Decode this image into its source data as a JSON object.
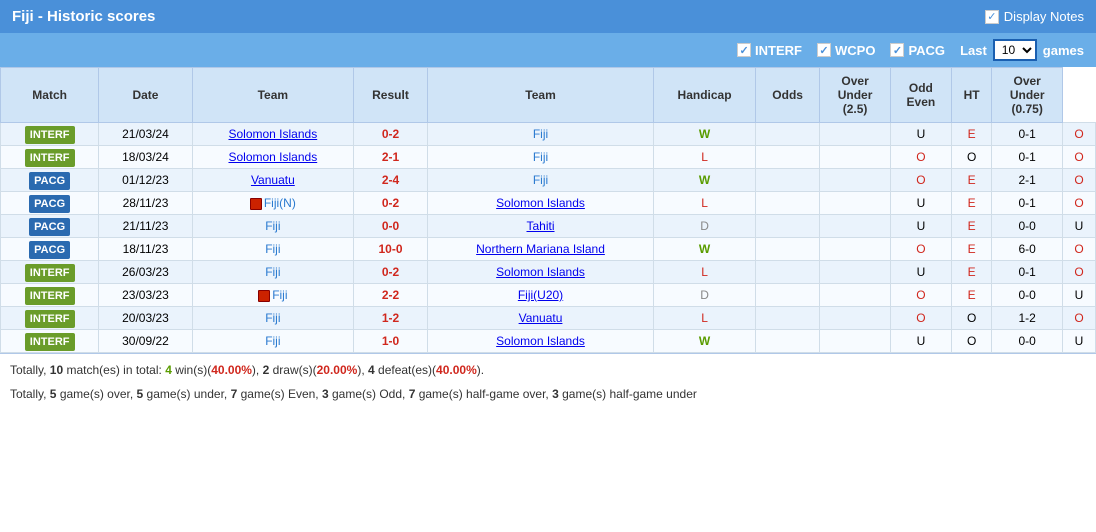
{
  "header": {
    "title": "Fiji - Historic scores",
    "display_notes_label": "Display Notes"
  },
  "filters": {
    "interf_label": "INTERF",
    "wcpo_label": "WCPO",
    "pacg_label": "PACG",
    "last_label": "Last",
    "games_label": "games",
    "last_value": "10"
  },
  "table": {
    "columns": [
      "Match",
      "Date",
      "Team",
      "Result",
      "Team",
      "Handicap",
      "Odds",
      "Over Under (2.5)",
      "Odd Even",
      "HT",
      "Over Under (0.75)"
    ],
    "rows": [
      {
        "type": "INTERF",
        "date": "21/03/24",
        "team1": "Solomon Islands",
        "team1_color": "black",
        "result": "0-2",
        "team2": "Fiji",
        "team2_color": "blue",
        "outcome": "W",
        "handicap": "",
        "odds": "",
        "ou25": "U",
        "oe": "E",
        "ht": "0-1",
        "ou075": "O"
      },
      {
        "type": "INTERF",
        "date": "18/03/24",
        "team1": "Solomon Islands",
        "team1_color": "black",
        "result": "2-1",
        "team2": "Fiji",
        "team2_color": "blue",
        "outcome": "L",
        "handicap": "",
        "odds": "",
        "ou25": "O",
        "oe": "O",
        "ht": "0-1",
        "ou075": "O"
      },
      {
        "type": "PACG",
        "date": "01/12/23",
        "team1": "Vanuatu",
        "team1_color": "black",
        "result": "2-4",
        "team2": "Fiji",
        "team2_color": "blue",
        "outcome": "W",
        "handicap": "",
        "odds": "",
        "ou25": "O",
        "oe": "E",
        "ht": "2-1",
        "ou075": "O"
      },
      {
        "type": "PACG",
        "date": "28/11/23",
        "team1": "Fiji(N)",
        "team1_color": "blue",
        "team1_flag": true,
        "result": "0-2",
        "team2": "Solomon Islands",
        "team2_color": "black",
        "outcome": "L",
        "handicap": "",
        "odds": "",
        "ou25": "U",
        "oe": "E",
        "ht": "0-1",
        "ou075": "O"
      },
      {
        "type": "PACG",
        "date": "21/11/23",
        "team1": "Fiji",
        "team1_color": "blue",
        "result": "0-0",
        "team2": "Tahiti",
        "team2_color": "black",
        "outcome": "D",
        "handicap": "",
        "odds": "",
        "ou25": "U",
        "oe": "E",
        "ht": "0-0",
        "ou075": "U"
      },
      {
        "type": "PACG",
        "date": "18/11/23",
        "team1": "Fiji",
        "team1_color": "blue",
        "result": "10-0",
        "team2": "Northern Mariana Island",
        "team2_color": "black",
        "outcome": "W",
        "handicap": "",
        "odds": "",
        "ou25": "O",
        "oe": "E",
        "ht": "6-0",
        "ou075": "O"
      },
      {
        "type": "INTERF",
        "date": "26/03/23",
        "team1": "Fiji",
        "team1_color": "blue",
        "result": "0-2",
        "team2": "Solomon Islands",
        "team2_color": "black",
        "outcome": "L",
        "handicap": "",
        "odds": "",
        "ou25": "U",
        "oe": "E",
        "ht": "0-1",
        "ou075": "O"
      },
      {
        "type": "INTERF",
        "date": "23/03/23",
        "team1": "Fiji",
        "team1_color": "blue",
        "team1_flag": true,
        "result": "2-2",
        "team2": "Fiji(U20)",
        "team2_color": "black",
        "outcome": "D",
        "handicap": "",
        "odds": "",
        "ou25": "O",
        "oe": "E",
        "ht": "0-0",
        "ou075": "U"
      },
      {
        "type": "INTERF",
        "date": "20/03/23",
        "team1": "Fiji",
        "team1_color": "blue",
        "result": "1-2",
        "team2": "Vanuatu",
        "team2_color": "black",
        "outcome": "L",
        "handicap": "",
        "odds": "",
        "ou25": "O",
        "oe": "O",
        "ht": "1-2",
        "ou075": "O"
      },
      {
        "type": "INTERF",
        "date": "30/09/22",
        "team1": "Fiji",
        "team1_color": "blue",
        "result": "1-0",
        "team2": "Solomon Islands",
        "team2_color": "black",
        "outcome": "W",
        "handicap": "",
        "odds": "",
        "ou25": "U",
        "oe": "O",
        "ht": "0-0",
        "ou075": "U"
      }
    ]
  },
  "summary": {
    "line1_pre": "Totally, ",
    "line1_total": "10",
    "line1_mid": " match(es) in total: ",
    "line1_wins": "4",
    "line1_wins_pct": "40.00%",
    "line1_draw_pre": ", ",
    "line1_draws": "2",
    "line1_draws_pct": "20.00%",
    "line1_defeat_pre": ", ",
    "line1_defeats": "4",
    "line1_defeats_pct": "40.00%",
    "line2": "Totally, 5 game(s) over, 5 game(s) under, 7 game(s) Even, 3 game(s) Odd, 7 game(s) half-game over, 3 game(s) half-game under"
  }
}
